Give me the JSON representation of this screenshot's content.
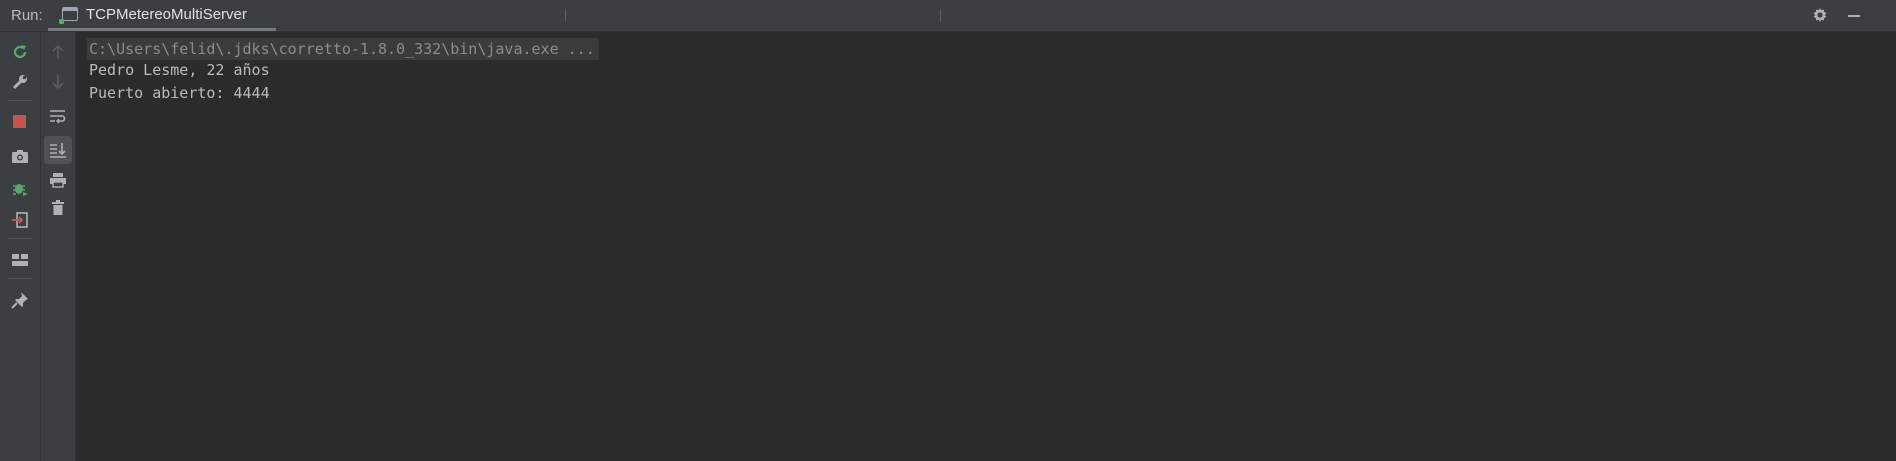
{
  "window": {
    "run_label": "Run:",
    "tab_title": "TCPMetereoMultiServer"
  },
  "toolbar_right": {
    "settings_icon": "gear-icon",
    "minimize_icon": "minus-icon"
  },
  "left_toolbar_1": [
    {
      "name": "rerun",
      "icon": "rerun-icon",
      "color": "#59a869"
    },
    {
      "name": "modify-run-configuration",
      "icon": "wrench-icon"
    },
    {
      "name": "stop",
      "icon": "stop-icon",
      "color": "#c75450"
    },
    {
      "name": "dump-threads",
      "icon": "camera-icon"
    },
    {
      "name": "debug-attach",
      "icon": "bug-icon",
      "color": "#59a869"
    },
    {
      "name": "exit",
      "icon": "exit-icon"
    },
    {
      "name": "layout",
      "icon": "layout-icon"
    },
    {
      "name": "pin-tab",
      "icon": "pin-icon"
    }
  ],
  "left_toolbar_2": [
    {
      "name": "up-stack-trace",
      "icon": "arrow-up-icon"
    },
    {
      "name": "down-stack-trace",
      "icon": "arrow-down-icon"
    },
    {
      "name": "soft-wrap",
      "icon": "soft-wrap-icon"
    },
    {
      "name": "scroll-to-end",
      "icon": "scroll-to-end-icon",
      "active": true
    },
    {
      "name": "print",
      "icon": "printer-icon"
    },
    {
      "name": "clear-all",
      "icon": "trash-icon"
    }
  ],
  "console": {
    "command_line": "C:\\Users\\felid\\.jdks\\corretto-1.8.0_332\\bin\\java.exe ...",
    "lines": [
      "Pedro Lesme, 22 años",
      "Puerto abierto: 4444"
    ]
  }
}
